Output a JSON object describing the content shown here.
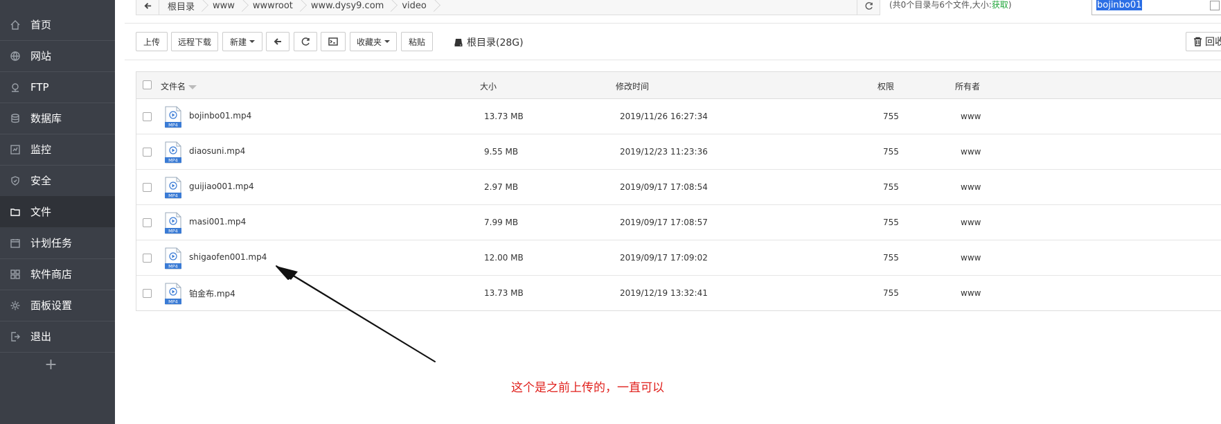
{
  "sidebar": {
    "items": [
      {
        "label": "首页",
        "icon": "home-icon"
      },
      {
        "label": "网站",
        "icon": "globe-icon"
      },
      {
        "label": "FTP",
        "icon": "ftp-icon"
      },
      {
        "label": "数据库",
        "icon": "database-icon"
      },
      {
        "label": "监控",
        "icon": "monitor-icon"
      },
      {
        "label": "安全",
        "icon": "shield-icon"
      },
      {
        "label": "文件",
        "icon": "folder-icon",
        "active": true
      },
      {
        "label": "计划任务",
        "icon": "calendar-icon"
      },
      {
        "label": "软件商店",
        "icon": "apps-icon"
      },
      {
        "label": "面板设置",
        "icon": "gear-icon"
      },
      {
        "label": "退出",
        "icon": "logout-icon"
      }
    ],
    "add_label": "+"
  },
  "path": {
    "crumbs": [
      "根目录",
      "www",
      "wwwroot",
      "www.dysy9.com",
      "video"
    ],
    "info_prefix": "(共0个目录与6个文件,大小:",
    "info_link": "获取",
    "info_suffix": ")"
  },
  "search": {
    "value": "bojinbo01"
  },
  "toolbar": {
    "upload": "上传",
    "remote_download": "远程下载",
    "new": "新建",
    "favorites": "收藏夹",
    "paste": "粘贴",
    "root_dir": "根目录(28G)",
    "recycle": "回收"
  },
  "table": {
    "headers": {
      "name": "文件名",
      "size": "大小",
      "mtime": "修改时间",
      "perm": "权限",
      "owner": "所有者"
    },
    "icon_label": "MP4",
    "rows": [
      {
        "name": "bojinbo01.mp4",
        "size": "13.73 MB",
        "mtime": "2019/11/26 16:27:34",
        "perm": "755",
        "owner": "www"
      },
      {
        "name": "diaosuni.mp4",
        "size": "9.55 MB",
        "mtime": "2019/12/23 11:23:36",
        "perm": "755",
        "owner": "www"
      },
      {
        "name": "guijiao001.mp4",
        "size": "2.97 MB",
        "mtime": "2019/09/17 17:08:54",
        "perm": "755",
        "owner": "www"
      },
      {
        "name": "masi001.mp4",
        "size": "7.99 MB",
        "mtime": "2019/09/17 17:08:57",
        "perm": "755",
        "owner": "www"
      },
      {
        "name": "shigaofen001.mp4",
        "size": "12.00 MB",
        "mtime": "2019/09/17 17:09:02",
        "perm": "755",
        "owner": "www"
      },
      {
        "name": "铂金布.mp4",
        "size": "13.73 MB",
        "mtime": "2019/12/19 13:32:41",
        "perm": "755",
        "owner": "www"
      }
    ]
  },
  "annotation": {
    "text": "这个是之前上传的，一直可以",
    "color": "#e0201c"
  }
}
